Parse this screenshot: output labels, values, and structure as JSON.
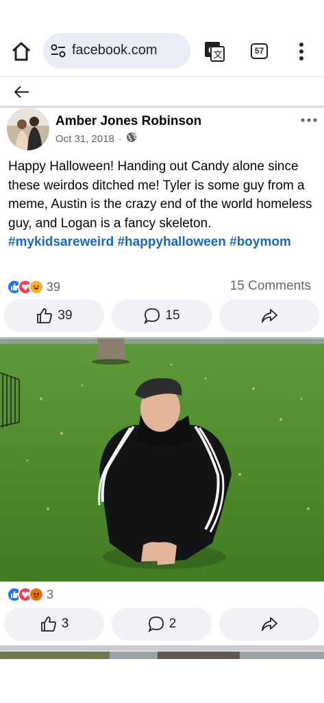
{
  "browser": {
    "url": "facebook.com",
    "tab_count": "57",
    "icons": [
      "home-icon",
      "site-settings-icon",
      "translate-icon",
      "tabs-icon",
      "more-vert-icon"
    ]
  },
  "post": {
    "author": "Amber Jones Robinson",
    "date": "Oct 31, 2018",
    "separator": "·",
    "privacy_icon": "globe-icon",
    "text": "Happy Halloween! Handing out Candy alone since these weirdos ditched me! Tyler is some guy from a meme, Austin is the crazy end of the world homeless guy, and Logan is a fancy skeleton.",
    "hashtags": "#mykidsareweird #happyhalloween #boymom",
    "reaction_count": "39",
    "comments_label": "15 Comments",
    "like_count": "39",
    "comment_count": "15"
  },
  "photo": {
    "reaction_count": "3",
    "like_count": "3",
    "comment_count": "2"
  },
  "colors": {
    "hashtag": "#1668c4",
    "like_blue": "#1877f2",
    "love_red": "#f33e58",
    "haha_yellow": "#f7b125",
    "angry_orange": "#e9710f",
    "button_bg": "#f0f2f5",
    "secondary_text": "#65676b"
  }
}
